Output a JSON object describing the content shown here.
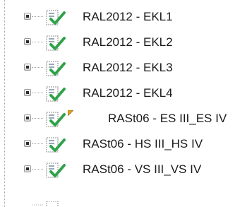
{
  "tree": {
    "items": [
      {
        "label": "RAL2012 - EKL1",
        "icon": "document-check-icon",
        "indented": false,
        "marker": false
      },
      {
        "label": "RAL2012 - EKL2",
        "icon": "document-check-icon",
        "indented": false,
        "marker": false
      },
      {
        "label": "RAL2012 - EKL3",
        "icon": "document-check-icon",
        "indented": false,
        "marker": false
      },
      {
        "label": "RAL2012 - EKL4",
        "icon": "document-check-icon",
        "indented": false,
        "marker": false
      },
      {
        "label": "RASt06 - ES III_ES IV",
        "icon": "document-check-icon",
        "indented": true,
        "marker": true
      },
      {
        "label": "RASt06 - HS III_HS IV",
        "icon": "document-check-icon",
        "indented": false,
        "marker": false
      },
      {
        "label": "RASt06 - VS III_VS IV",
        "icon": "document-check-icon",
        "indented": false,
        "marker": false
      }
    ]
  },
  "colors": {
    "check": "#2fa24a",
    "marker": "#e0a020",
    "dotted_line": "#a9a9a9",
    "text": "#1a1a1a"
  }
}
